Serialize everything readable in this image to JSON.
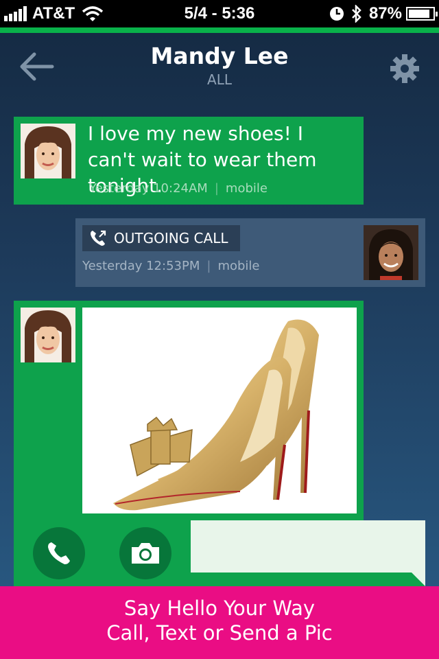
{
  "status_bar": {
    "carrier": "AT&T",
    "time": "5/4 - 5:36",
    "battery": "87%",
    "battery_level": 0.87,
    "icons": [
      "signal-icon",
      "wifi-icon",
      "clock-icon",
      "bluetooth-icon",
      "battery-icon"
    ]
  },
  "header": {
    "title": "Mandy Lee",
    "subtitle": "ALL",
    "back_icon": "back-arrow-icon",
    "settings_icon": "gear-icon"
  },
  "messages": [
    {
      "type": "text",
      "direction": "incoming",
      "text": "I love my new shoes! I can't wait to wear them tonight.",
      "time": "Yesterday 10:24AM",
      "source": "mobile"
    },
    {
      "type": "call",
      "direction": "outgoing",
      "label": "OUTGOING CALL",
      "time": "Yesterday 12:53PM",
      "source": "mobile"
    },
    {
      "type": "photo",
      "direction": "incoming",
      "subject": "gold snakeskin high-heel pumps with bow"
    }
  ],
  "composer": {
    "call_icon": "phone-icon",
    "camera_icon": "camera-icon",
    "input_value": ""
  },
  "banner": {
    "line1": "Say Hello Your Way",
    "line2": "Call, Text or Send a Pic"
  },
  "colors": {
    "accent_green": "#0ea24c",
    "banner_pink": "#ea0d84",
    "call_card": "#3e5a78",
    "background_top": "#152b44",
    "background_bottom": "#2a5d87"
  }
}
